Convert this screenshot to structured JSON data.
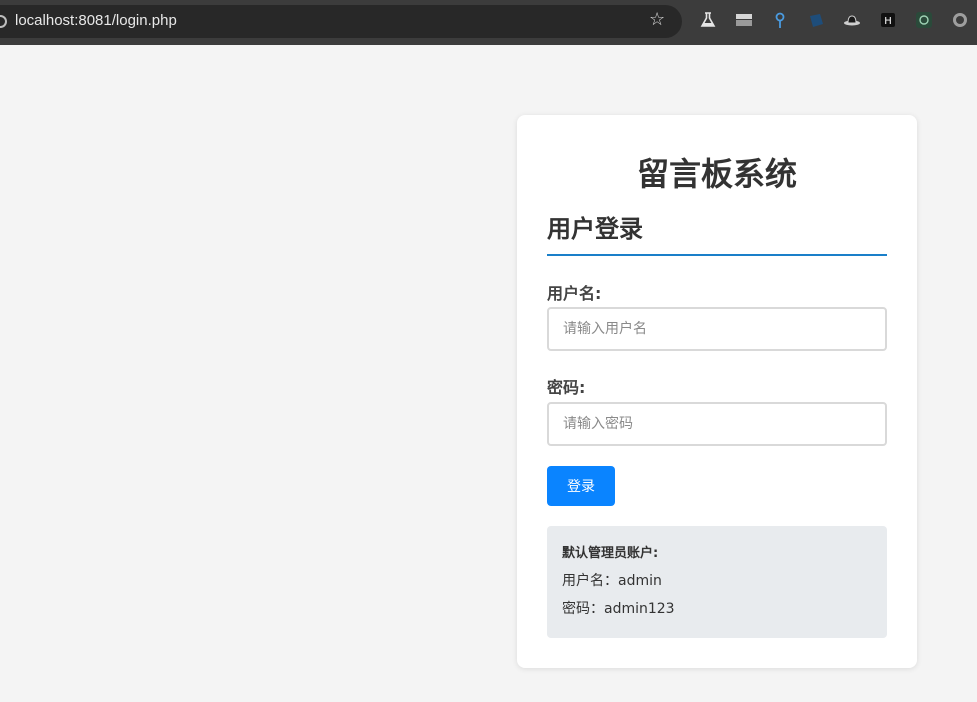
{
  "browser": {
    "url": "localhost:8081/login.php",
    "bookmark_icon": "star-icon",
    "extensions": [
      "flask-icon",
      "tab-manager-icon",
      "pin-icon",
      "tilted-square-icon",
      "hat-icon",
      "h-icon",
      "window-icon",
      "circle-icon"
    ]
  },
  "page": {
    "system_title": "留言板系统",
    "login_title": "用户登录",
    "form": {
      "username_label": "用户名:",
      "username_placeholder": "请输入用户名",
      "username_value": "",
      "password_label": "密码:",
      "password_placeholder": "请输入密码",
      "password_value": "",
      "submit_label": "登录"
    },
    "default_account": {
      "heading": "默认管理员账户:",
      "username_line": "用户名：admin",
      "password_line": "密码：admin123"
    }
  },
  "colors": {
    "accent": "#1a7fc9",
    "button": "#0a84ff",
    "page_bg": "#f4f4f4",
    "info_bg": "#e8ebee"
  }
}
